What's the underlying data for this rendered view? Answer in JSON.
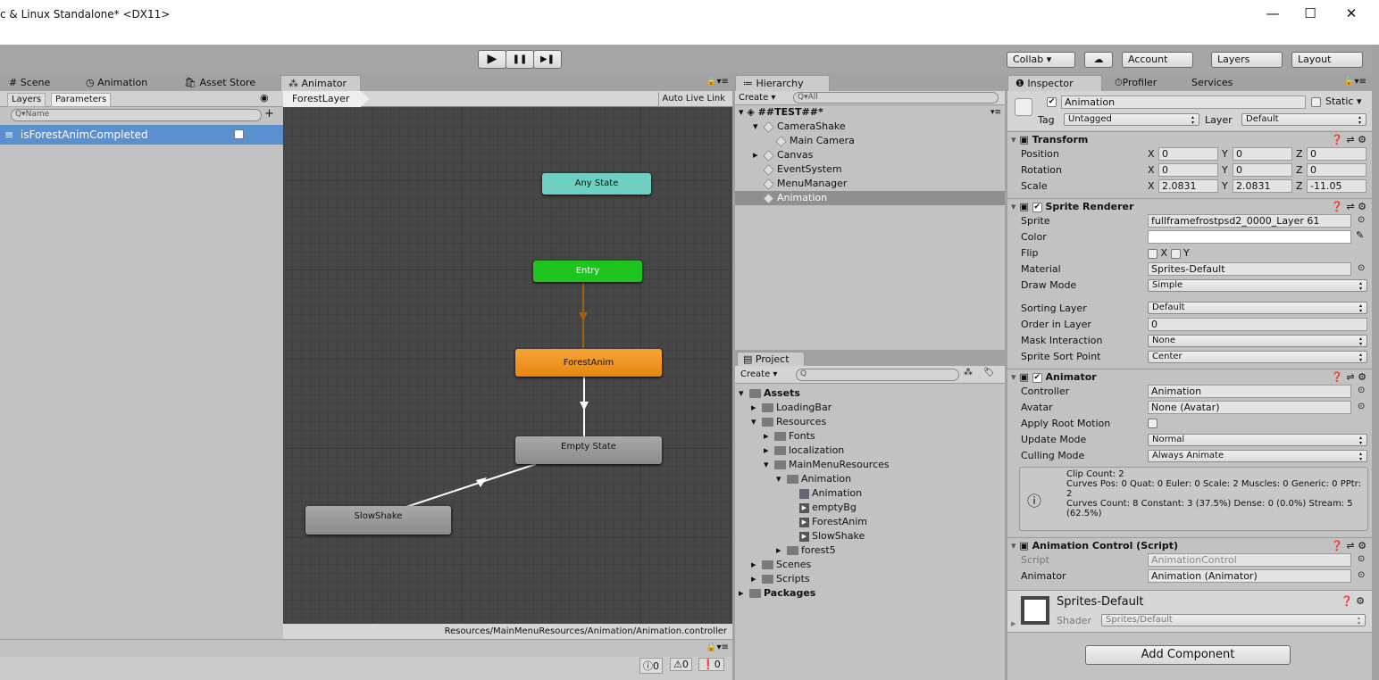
{
  "window": {
    "title": "c & Linux Standalone* <DX11>",
    "minimize": "—",
    "maximize": "☐",
    "close": "✕"
  },
  "toolbar": {
    "play": "▶",
    "pause": "❚❚",
    "step": "▶❚",
    "collab": "Collab ▾",
    "cloud": "☁",
    "account": "Account",
    "layers": "Layers",
    "layout": "Layout"
  },
  "left_tabs": [
    {
      "icon": "#",
      "label": "Scene"
    },
    {
      "icon": "◷",
      "label": "Animation"
    },
    {
      "icon": "🛍",
      "label": "Asset Store"
    },
    {
      "icon": "⁂",
      "label": "Animator"
    }
  ],
  "animator": {
    "subtabs": [
      "Layers",
      "Parameters"
    ],
    "search_placeholder": "Name",
    "add": "+",
    "parameters": [
      {
        "name": "isForestAnimCompleted",
        "value": false
      }
    ],
    "breadcrumb": "ForestLayer",
    "auto_live_link": "Auto Live Link",
    "states": {
      "any": "Any State",
      "entry": "Entry",
      "forest": "ForestAnim",
      "empty": "Empty State",
      "slow": "SlowShake"
    },
    "path": "Resources/MainMenuResources/Animation/Animation.controller",
    "colors": {
      "any": "#6fcfc2",
      "entry": "#1fc41f",
      "default": "#f0901a",
      "normal": "#9a9a9a"
    }
  },
  "console": {
    "info": "0",
    "warn": "0",
    "error": "0"
  },
  "hierarchy": {
    "tab": "Hierarchy",
    "create": "Create ▾",
    "search_placeholder": "All",
    "scene": "##TEST##*",
    "items": [
      {
        "label": "CameraShake",
        "depth": 1,
        "arrow": "▾"
      },
      {
        "label": "Main Camera",
        "depth": 2,
        "arrow": ""
      },
      {
        "label": "Canvas",
        "depth": 1,
        "arrow": "▸"
      },
      {
        "label": "EventSystem",
        "depth": 1,
        "arrow": ""
      },
      {
        "label": "MenuManager",
        "depth": 1,
        "arrow": ""
      },
      {
        "label": "Animation",
        "depth": 1,
        "arrow": "",
        "selected": true
      }
    ]
  },
  "project": {
    "tab": "Project",
    "create": "Create ▾",
    "items": [
      {
        "label": "Assets",
        "depth": 0,
        "arrow": "▾",
        "bold": true,
        "type": "folder"
      },
      {
        "label": "LoadingBar",
        "depth": 1,
        "arrow": "▸",
        "type": "folder"
      },
      {
        "label": "Resources",
        "depth": 1,
        "arrow": "▾",
        "type": "folder"
      },
      {
        "label": "Fonts",
        "depth": 2,
        "arrow": "▸",
        "type": "folder"
      },
      {
        "label": "localization",
        "depth": 2,
        "arrow": "▸",
        "type": "folder"
      },
      {
        "label": "MainMenuResources",
        "depth": 2,
        "arrow": "▾",
        "type": "folder"
      },
      {
        "label": "Animation",
        "depth": 3,
        "arrow": "▾",
        "type": "folder"
      },
      {
        "label": "Animation",
        "depth": 4,
        "arrow": "",
        "type": "controller"
      },
      {
        "label": "emptyBg",
        "depth": 4,
        "arrow": "",
        "type": "clip"
      },
      {
        "label": "ForestAnim",
        "depth": 4,
        "arrow": "",
        "type": "clip"
      },
      {
        "label": "SlowShake",
        "depth": 4,
        "arrow": "",
        "type": "clip"
      },
      {
        "label": "forest5",
        "depth": 3,
        "arrow": "▸",
        "type": "folder"
      },
      {
        "label": "Scenes",
        "depth": 1,
        "arrow": "▸",
        "type": "folder"
      },
      {
        "label": "Scripts",
        "depth": 1,
        "arrow": "▸",
        "type": "folder"
      },
      {
        "label": "Packages",
        "depth": 0,
        "arrow": "▸",
        "bold": true,
        "type": "folder"
      }
    ]
  },
  "inspector": {
    "tabs": [
      "Inspector",
      "Profiler",
      "Services"
    ],
    "name": "Animation",
    "static": "Static",
    "tag_label": "Tag",
    "tag": "Untagged",
    "layer_label": "Layer",
    "layer": "Default",
    "transform": {
      "title": "Transform",
      "rows": [
        {
          "label": "Position",
          "x": "0",
          "y": "0",
          "z": "0"
        },
        {
          "label": "Rotation",
          "x": "0",
          "y": "0",
          "z": "0"
        },
        {
          "label": "Scale",
          "x": "2.0831",
          "y": "2.0831",
          "z": "-11.05"
        }
      ]
    },
    "sprite_renderer": {
      "title": "Sprite Renderer",
      "sprite_label": "Sprite",
      "sprite": "fullframefrostpsd2_0000_Layer 61",
      "color_label": "Color",
      "flip_label": "Flip",
      "flip_x": "X",
      "flip_y": "Y",
      "material_label": "Material",
      "material": "Sprites-Default",
      "draw_mode_label": "Draw Mode",
      "draw_mode": "Simple",
      "sorting_layer_label": "Sorting Layer",
      "sorting_layer": "Default",
      "order_label": "Order in Layer",
      "order": "0",
      "mask_label": "Mask Interaction",
      "mask": "None",
      "sort_point_label": "Sprite Sort Point",
      "sort_point": "Center"
    },
    "animator": {
      "title": "Animator",
      "controller_label": "Controller",
      "controller": "Animation",
      "avatar_label": "Avatar",
      "avatar": "None (Avatar)",
      "root_motion_label": "Apply Root Motion",
      "update_label": "Update Mode",
      "update": "Normal",
      "culling_label": "Culling Mode",
      "culling": "Always Animate",
      "info": [
        "Clip Count: 2",
        "Curves Pos: 0 Quat: 0 Euler: 0 Scale: 2 Muscles: 0 Generic: 0 PPtr:",
        "2",
        "Curves Count: 8 Constant: 3 (37.5%) Dense: 0 (0.0%) Stream: 5",
        "(62.5%)"
      ]
    },
    "script": {
      "title": "Animation Control (Script)",
      "script_label": "Script",
      "script": "AnimationControl",
      "animator_label": "Animator",
      "animator": "Animation (Animator)"
    },
    "material": {
      "name": "Sprites-Default",
      "shader_label": "Shader",
      "shader": "Sprites/Default"
    },
    "add_component": "Add Component"
  }
}
